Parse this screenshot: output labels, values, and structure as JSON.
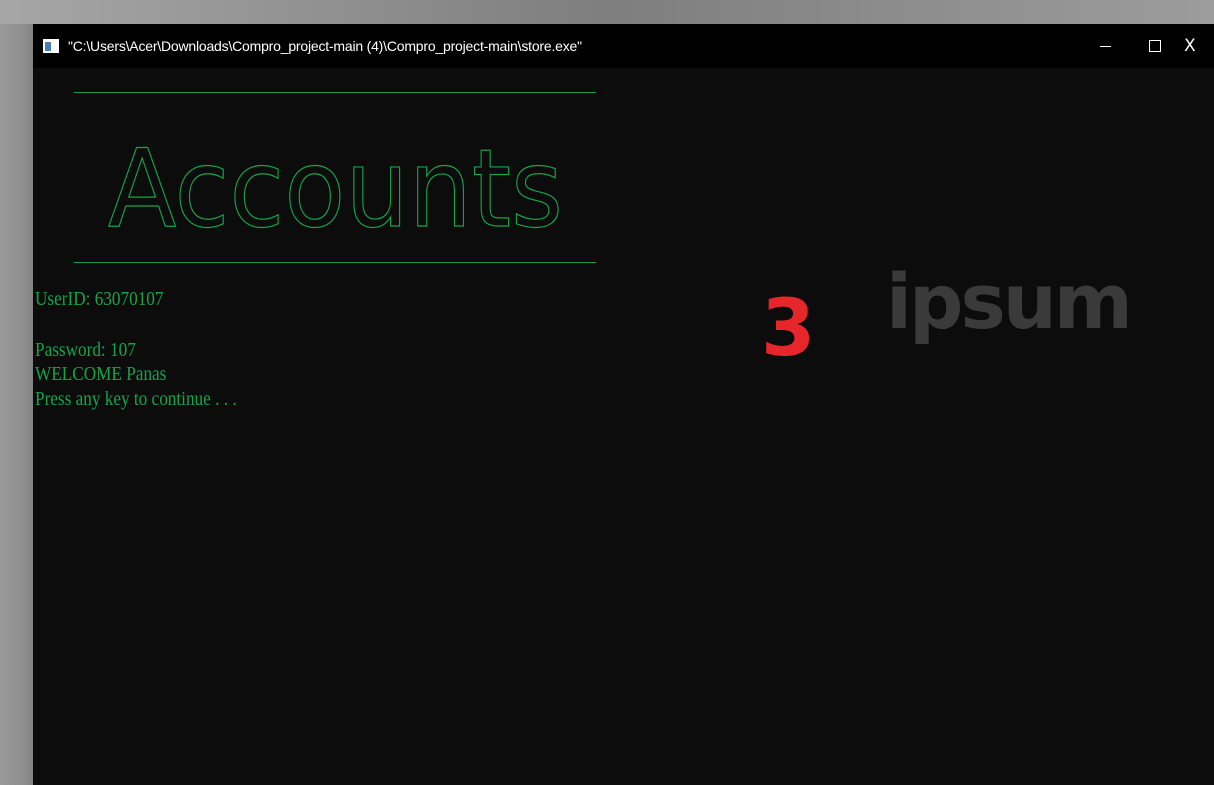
{
  "window": {
    "title": "\"C:\\Users\\Acer\\Downloads\\Compro_project-main (4)\\Compro_project-main\\store.exe\"",
    "controls": {
      "minimize": "",
      "maximize": "",
      "close": "X"
    }
  },
  "console": {
    "banner": "Accounts",
    "lines": [
      "UserID: 63070107",
      "Password: 107",
      "WELCOME Panas",
      "Press any key to continue . . ."
    ]
  },
  "overlay": {
    "number": "3",
    "word": "ipsum"
  },
  "colors": {
    "console_text": "#16a34a",
    "console_bg": "#0c0c0c",
    "titlebar_bg": "#000000",
    "overlay_number": "#e6262b",
    "overlay_word": "#3a3a3a"
  },
  "icons": {
    "app": "console-app-icon",
    "minimize": "minimize-icon",
    "maximize": "maximize-icon",
    "close": "close-icon"
  }
}
